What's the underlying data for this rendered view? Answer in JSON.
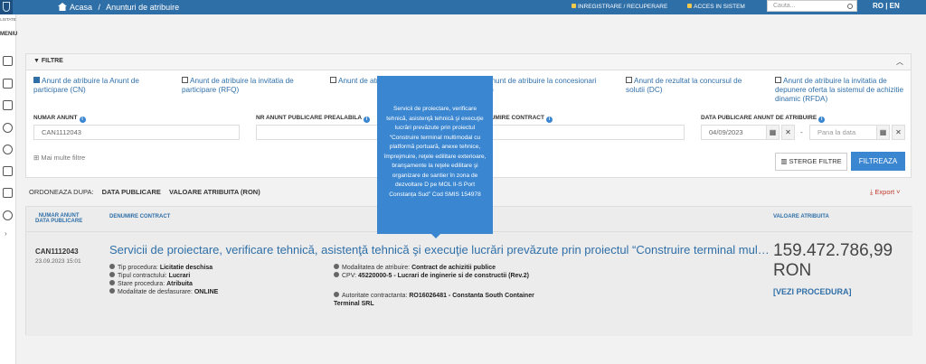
{
  "topbar": {
    "breadcrumb_home": "Acasa",
    "breadcrumb_sep": "/",
    "breadcrumb_current": "Anunturi de atribuire",
    "register": "INREGISTRARE / RECUPERARE",
    "access": "ACCES IN SISTEM",
    "search_placeholder": "Cauta...",
    "lang": "RO | EN",
    "brand_color": "#2f6fa8"
  },
  "sidebar": {
    "label_top": "LISTATE",
    "menu": "MENIU",
    "icons": [
      "document-icon",
      "list-icon",
      "certificate-icon",
      "help-icon",
      "user-settings-icon",
      "address-card-icon",
      "monitor-icon",
      "chat-icon"
    ]
  },
  "filters": {
    "title": "FILTRE",
    "checkboxes": [
      {
        "label": "Anunt de atribuire la Anunt de participare (CN)",
        "checked": true
      },
      {
        "label": "Anunt de atribuire la invitatia de participare (RFQ)",
        "checked": false
      },
      {
        "label": "Anunt de atribuire simplificat (SCN)",
        "checked": false
      },
      {
        "label": "Anunt de atribuire la concesionari (PC)",
        "checked": false
      },
      {
        "label": "Anunt de rezultat la concursul de solutii (DC)",
        "checked": false
      },
      {
        "label": "Anunt de atribuire la invitatia de depunere oferta la sistemul de achizitie dinamic (RFDA)",
        "checked": false
      }
    ],
    "label_numar": "NUMAR ANUNT",
    "value_numar": "CAN1112043",
    "label_nr_prealabila": "NR ANUNT PUBLICARE PREALABILA",
    "label_contract": "DENUMIRE CONTRACT",
    "label_data": "DATA PUBLICARE ANUNT DE ATRIBUIRE",
    "date_from": "04/09/2023",
    "date_sep": "-",
    "date_to_placeholder": "Pana la data",
    "more": "Mai multe filtre",
    "clear": "STERGE FILTRE",
    "apply": "FILTREAZA"
  },
  "order": {
    "label": "ORDONEAZA DUPA:",
    "opt1": "DATA PUBLICARE",
    "opt2": "VALOARE ATRIBUITA (RON)",
    "export": "Export"
  },
  "results": {
    "headers": {
      "num1": "NUMAR ANUNT",
      "num2": "DATA PUBLICARE",
      "contract": "DENUMIRE CONTRACT",
      "value": "VALOARE ATRIBUITA"
    },
    "row": {
      "number": "CAN1112043",
      "date": "23.09.2023 15:01",
      "title": "Servicii de proiectare, verificare tehnică, asistenţă tehnică şi execuţie lucrări prevăzute prin proiectul “Construire terminal multi...",
      "tip_procedura_label": "Tip procedura:",
      "tip_procedura": "Licitatie deschisa",
      "tip_contract_label": "Tipul contractului:",
      "tip_contract": "Lucrari",
      "stare_label": "Stare procedura:",
      "stare": "Atribuita",
      "modalitate_label": "Modalitate de desfasurare:",
      "modalitate": "ONLINE",
      "mod_atribuire_label": "Modalitatea de atribuire:",
      "mod_atribuire": "Contract de achizitii publice",
      "cpv_label": "CPV:",
      "cpv": "45220000-5 - Lucrari de inginerie si de constructii (Rev.2)",
      "autoritate_label": "Autoritate contractanta:",
      "autoritate": "RO16026481 - Constanta South Container Terminal SRL",
      "value": "159.472.786,99",
      "currency": "RON",
      "link": "[VEZI PROCEDURA]"
    }
  },
  "tooltip": "Servicii de proiectare, verificare tehnică, asistenţă tehnică şi execuţie lucrări prevăzute prin proiectul “Construire terminal multimodal cu platformă portuară, anexe tehnice, împrejmuire, reţele edilitare exterioare, branşamente la reţele edilitare şi organizare de santier în zona de dezvoltare D pe MOL II-S Port Constanța Sud” Cod SMIS 154978"
}
